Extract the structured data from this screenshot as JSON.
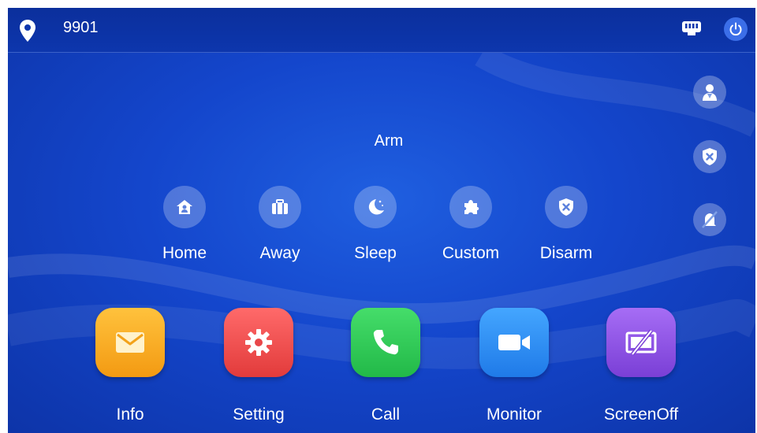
{
  "status_bar": {
    "room_number": "9901",
    "location_icon": "location-pin-icon",
    "network_icon": "ethernet-icon",
    "power_icon": "power-icon"
  },
  "side_buttons": [
    {
      "name": "user-manager-icon"
    },
    {
      "name": "disarm-shield-icon"
    },
    {
      "name": "mute-alarm-icon"
    }
  ],
  "arm": {
    "title": "Arm",
    "modes": [
      {
        "label": "Home",
        "icon": "home-icon"
      },
      {
        "label": "Away",
        "icon": "briefcase-icon"
      },
      {
        "label": "Sleep",
        "icon": "moon-icon"
      },
      {
        "label": "Custom",
        "icon": "puzzle-icon"
      },
      {
        "label": "Disarm",
        "icon": "shield-x-icon"
      }
    ]
  },
  "apps": [
    {
      "label": "Info",
      "icon": "mail-icon",
      "color": "#f5a623"
    },
    {
      "label": "Setting",
      "icon": "gear-icon",
      "color": "#ef4b4b"
    },
    {
      "label": "Call",
      "icon": "phone-icon",
      "color": "#2ecc55"
    },
    {
      "label": "Monitor",
      "icon": "video-camera-icon",
      "color": "#2f8cf0"
    },
    {
      "label": "ScreenOff",
      "icon": "screen-off-icon",
      "color": "#8a4fe0"
    }
  ]
}
